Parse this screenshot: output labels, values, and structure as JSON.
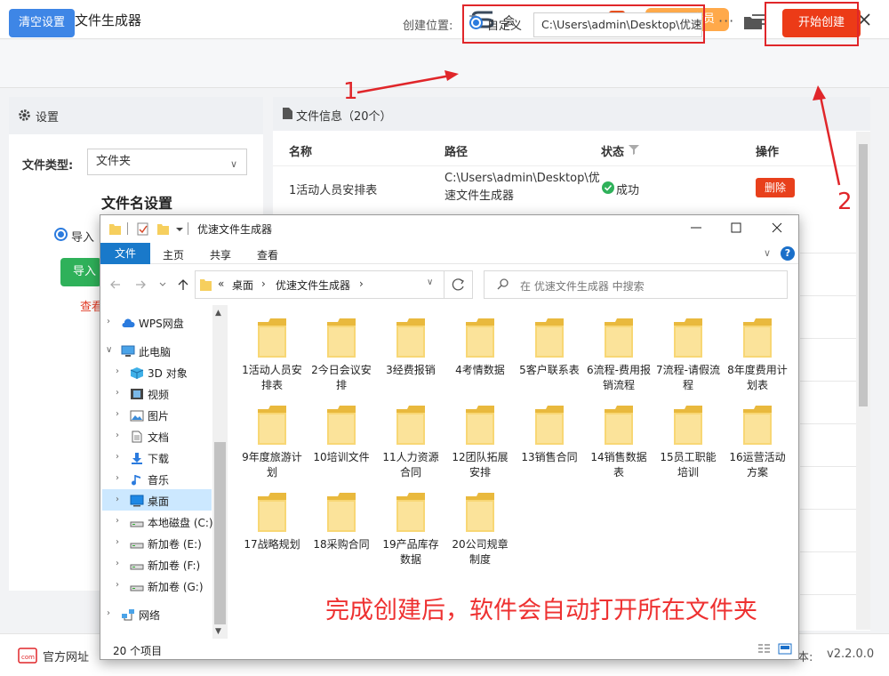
{
  "app": {
    "title": "优速文件生成器",
    "vip_label": "会",
    "vip_button": "开通会员",
    "k_glyph": "K"
  },
  "toolbar": {
    "clear_label": "清空设置",
    "location_label": "创建位置:",
    "custom_label": "自定义",
    "path_value": "C:\\Users\\admin\\Desktop\\优速",
    "more_label": "···",
    "start_label": "开始创建"
  },
  "settings": {
    "header": "设置",
    "filetype_label": "文件类型:",
    "filetype_value": "文件夹",
    "name_settings": "文件名设置",
    "import_label": "导入",
    "import_button": "导入",
    "view_link": "查看"
  },
  "file_info": {
    "title": "文件信息（20个）",
    "columns": {
      "name": "名称",
      "path": "路径",
      "status": "状态",
      "action": "操作"
    },
    "rows": [
      {
        "name": "1活动人员安排表",
        "path": "C:\\Users\\admin\\Desktop\\优速文件生成器",
        "status": "成功",
        "action": "删除"
      }
    ]
  },
  "bottom": {
    "site_label": "官方网址",
    "version_prefix": "本:",
    "version": "v2.2.0.0"
  },
  "explorer": {
    "title": "优速文件生成器",
    "tabs": [
      "文件",
      "主页",
      "共享",
      "查看"
    ],
    "breadcrumb": [
      "«",
      "桌面",
      "›",
      "优速文件生成器",
      "›"
    ],
    "search_placeholder": "在 优速文件生成器 中搜索",
    "nav": [
      {
        "label": "WPS网盘",
        "icon": "cloud-icon"
      },
      {
        "label": "此电脑",
        "icon": "pc-icon"
      },
      {
        "label": "3D 对象",
        "icon": "3d-objects-icon"
      },
      {
        "label": "视频",
        "icon": "video-icon"
      },
      {
        "label": "图片",
        "icon": "picture-icon"
      },
      {
        "label": "文档",
        "icon": "document-icon"
      },
      {
        "label": "下载",
        "icon": "download-icon"
      },
      {
        "label": "音乐",
        "icon": "music-icon"
      },
      {
        "label": "桌面",
        "icon": "desktop-icon"
      },
      {
        "label": "本地磁盘 (C:)",
        "icon": "drive-icon"
      },
      {
        "label": "新加卷 (E:)",
        "icon": "drive-icon"
      },
      {
        "label": "新加卷 (F:)",
        "icon": "drive-icon"
      },
      {
        "label": "新加卷 (G:)",
        "icon": "drive-icon"
      },
      {
        "label": "网络",
        "icon": "network-icon"
      }
    ],
    "folders": [
      "1活动人员安排表",
      "2今日会议安排",
      "3经费报销",
      "4考情数据",
      "5客户联系表",
      "6流程-费用报销流程",
      "7流程-请假流程",
      "8年度费用计划表",
      "9年度旅游计划",
      "10培训文件",
      "11人力资源合同",
      "12团队拓展安排",
      "13销售合同",
      "14销售数据表",
      "15员工职能培训",
      "16运营活动方案",
      "17战略规划",
      "18采购合同",
      "19产品库存数据",
      "20公司规章制度"
    ],
    "item_count": "20 个项目"
  },
  "annotation": "完成创建后，软件会自动打开所在文件夹",
  "markers": {
    "one": "1",
    "two": "2"
  },
  "colors": {
    "accent_red": "#ec3b17",
    "primary_blue": "#3e86e6",
    "folder_yellow": "#f8d775",
    "success_green": "#2fb15a"
  }
}
